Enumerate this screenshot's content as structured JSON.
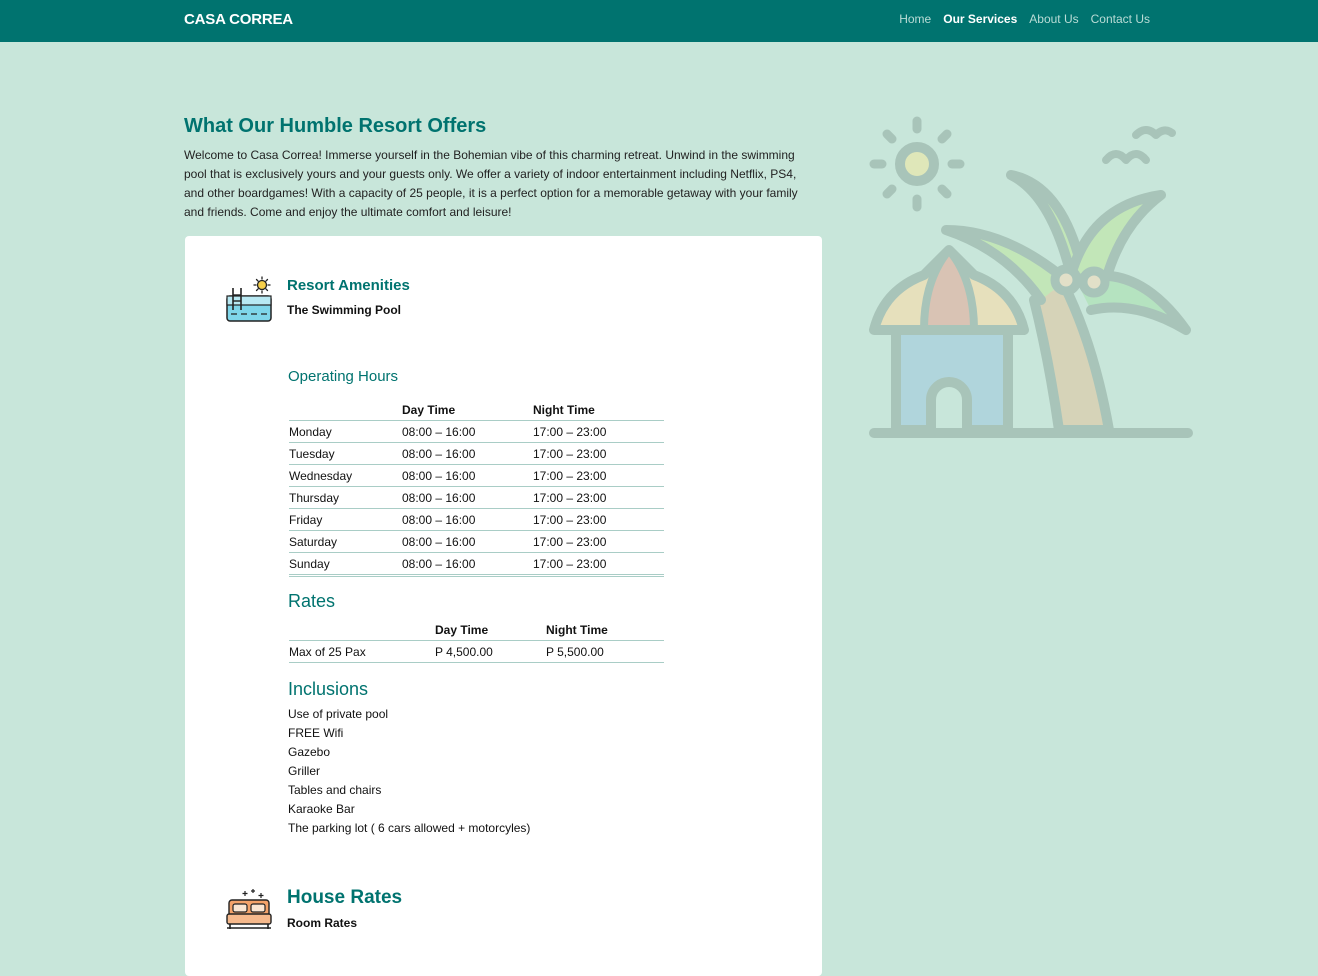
{
  "nav": {
    "brand": "CASA CORREA",
    "links": [
      {
        "label": "Home",
        "active": false
      },
      {
        "label": "Our Services",
        "active": true
      },
      {
        "label": "About Us",
        "active": false
      },
      {
        "label": "Contact Us",
        "active": false
      }
    ]
  },
  "page": {
    "title": "What Our Humble Resort Offers",
    "intro": "Welcome to Casa Correa! Immerse yourself in the Bohemian vibe of this charming retreat. Unwind in the swimming pool that is exclusively yours and your guests only. We offer a variety of indoor entertainment including Netflix, PS4, and other boardgames! With a capacity of 25 people, it is a perfect option for a memorable getaway with your family and friends. Come and enjoy the ultimate comfort and leisure!"
  },
  "amenities": {
    "icon": "swimming-pool-icon",
    "title": "Resort Amenities",
    "subtitle": "The Swimming Pool",
    "hours": {
      "heading": "Operating Hours",
      "columns": [
        "",
        "Day Time",
        "Night Time"
      ],
      "rows": [
        [
          "Monday",
          "08:00 – 16:00",
          "17:00 – 23:00"
        ],
        [
          "Tuesday",
          "08:00 – 16:00",
          "17:00 – 23:00"
        ],
        [
          "Wednesday",
          "08:00 – 16:00",
          "17:00 – 23:00"
        ],
        [
          "Thursday",
          "08:00 – 16:00",
          "17:00 – 23:00"
        ],
        [
          "Friday",
          "08:00 – 16:00",
          "17:00 – 23:00"
        ],
        [
          "Saturday",
          "08:00 – 16:00",
          "17:00 – 23:00"
        ],
        [
          "Sunday",
          "08:00 – 16:00",
          "17:00 – 23:00"
        ]
      ]
    },
    "rates": {
      "heading": "Rates",
      "columns": [
        "",
        "Day Time",
        "Night Time"
      ],
      "rows": [
        [
          "Max of 25 Pax",
          "P 4,500.00",
          "P 5,500.00"
        ]
      ]
    },
    "inclusions": {
      "heading": "Inclusions",
      "items": [
        "Use of private pool",
        "FREE Wifi",
        "Gazebo",
        "Griller",
        "Tables and chairs",
        "Karaoke Bar",
        "The parking lot ( 6 cars allowed + motorcyles)"
      ]
    }
  },
  "house": {
    "icon": "bed-icon",
    "title": "House Rates",
    "subtitle": "Room Rates"
  },
  "hero": {
    "icon": "beach-hut-palm-illustration"
  },
  "colors": {
    "primary": "#00736f",
    "background": "#c8e6da",
    "nav_inactive": "#b9dcd6",
    "table_border": "#a9cdc6"
  }
}
